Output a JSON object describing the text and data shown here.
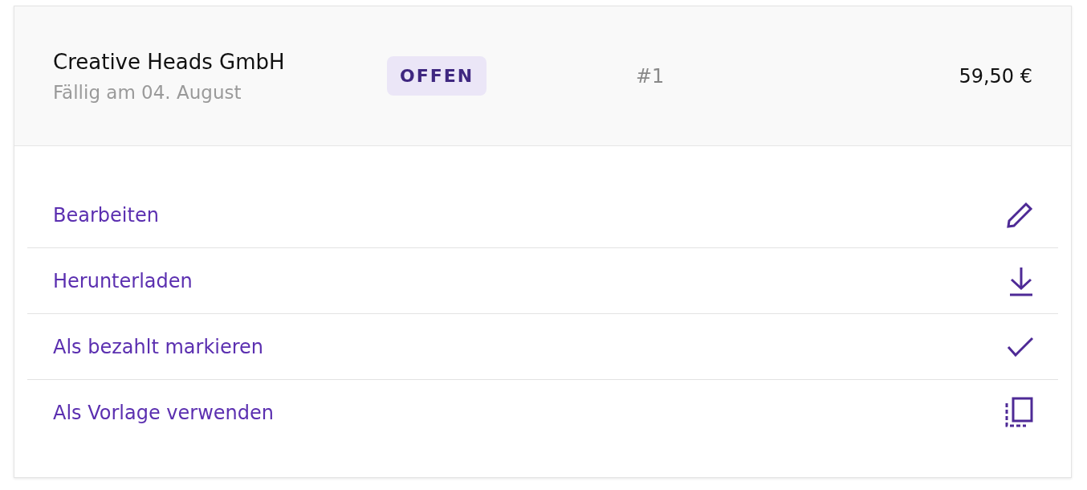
{
  "invoice": {
    "client": "Creative Heads GmbH",
    "due": "Fällig am 04. August",
    "status": "OFFEN",
    "number": "#1",
    "amount": "59,50 €"
  },
  "actions": [
    {
      "label": "Bearbeiten",
      "kind": "edit"
    },
    {
      "label": "Herunterladen",
      "kind": "download"
    },
    {
      "label": "Als bezahlt markieren",
      "kind": "check"
    },
    {
      "label": "Als Vorlage verwenden",
      "kind": "copy"
    }
  ]
}
